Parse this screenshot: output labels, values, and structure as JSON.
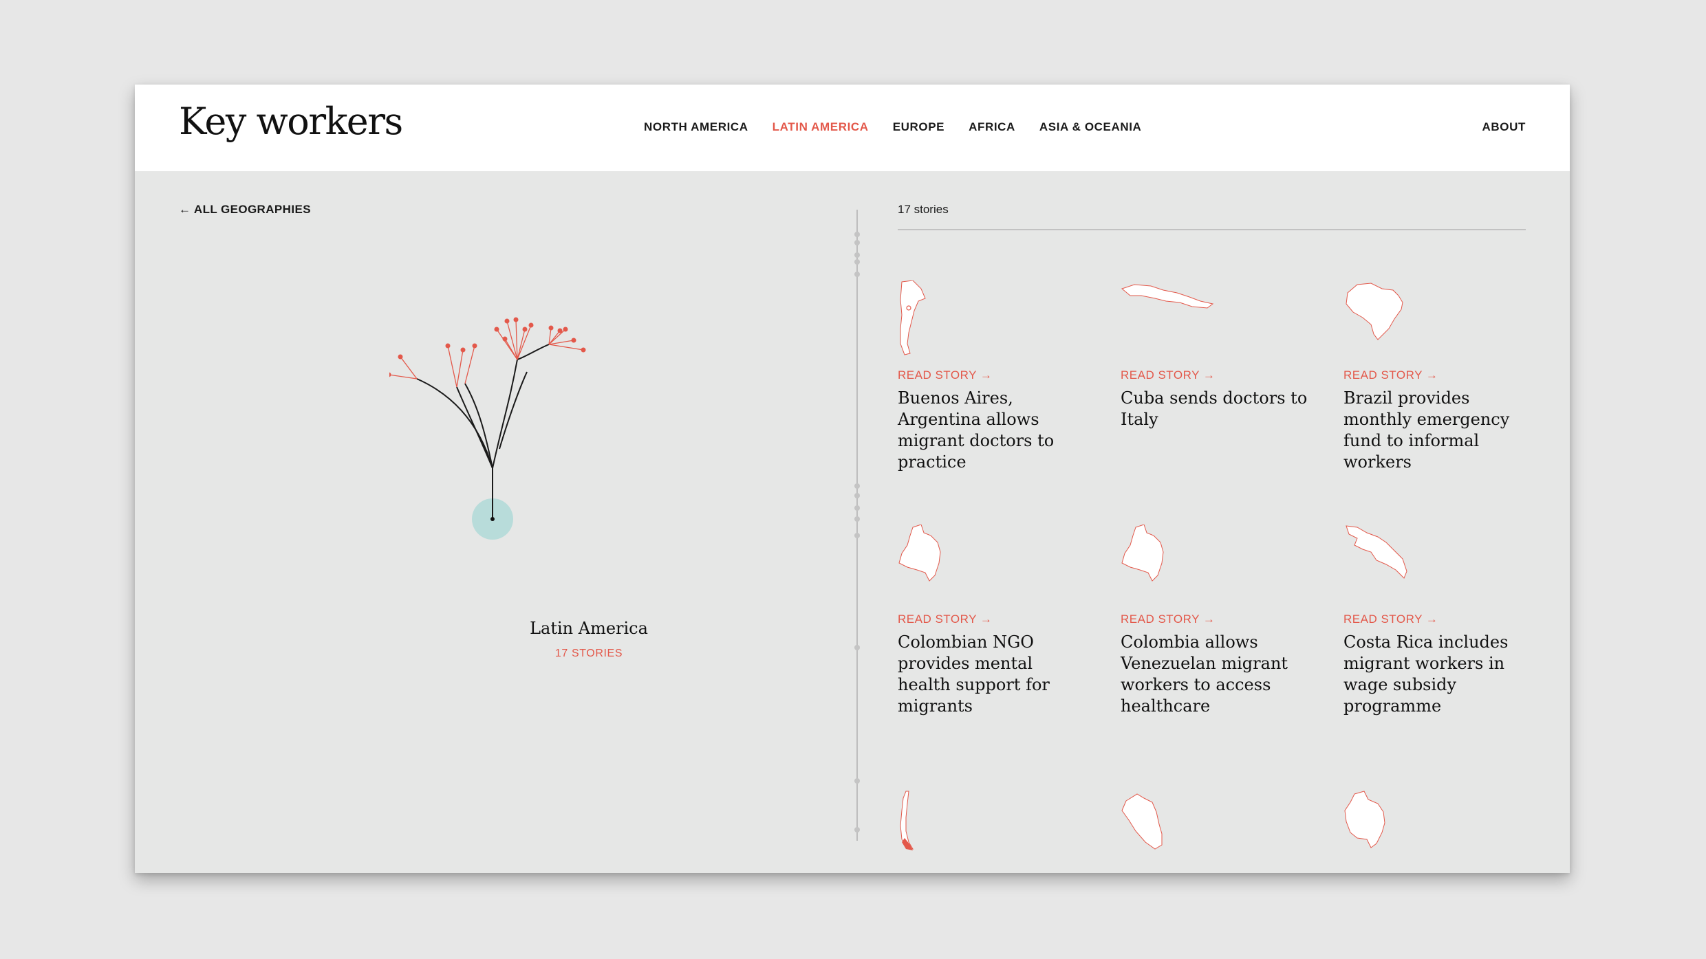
{
  "header": {
    "logo": "Key workers",
    "nav": [
      {
        "label": "NORTH AMERICA",
        "active": false
      },
      {
        "label": "LATIN AMERICA",
        "active": true
      },
      {
        "label": "EUROPE",
        "active": false
      },
      {
        "label": "AFRICA",
        "active": false
      },
      {
        "label": "ASIA & OCEANIA",
        "active": false
      }
    ],
    "about": "ABOUT"
  },
  "sidebar": {
    "back_label": "← ALL GEOGRAPHIES",
    "region_title": "Latin America",
    "region_count": "17 STORIES"
  },
  "stories": {
    "count_label": "17 stories",
    "read_label": "READ STORY →",
    "items": [
      {
        "title": "Buenos Aires, Argentina allows migrant doctors to practice",
        "map": "argentina"
      },
      {
        "title": "Cuba sends doctors to Italy",
        "map": "cuba"
      },
      {
        "title": "Brazil provides monthly emergency fund to informal workers",
        "map": "brazil"
      },
      {
        "title": "Colombian NGO provides mental health support for migrants",
        "map": "colombia"
      },
      {
        "title": "Colombia allows Venezuelan migrant workers to access healthcare",
        "map": "colombia"
      },
      {
        "title": "Costa Rica includes migrant workers in wage subsidy programme",
        "map": "costa-rica"
      },
      {
        "title": "",
        "map": "chile"
      },
      {
        "title": "",
        "map": "peru"
      },
      {
        "title": "",
        "map": "bolivia"
      }
    ]
  },
  "colors": {
    "accent": "#e3584a",
    "background": "#e6e7e6",
    "root_circle": "#b8dcda"
  }
}
